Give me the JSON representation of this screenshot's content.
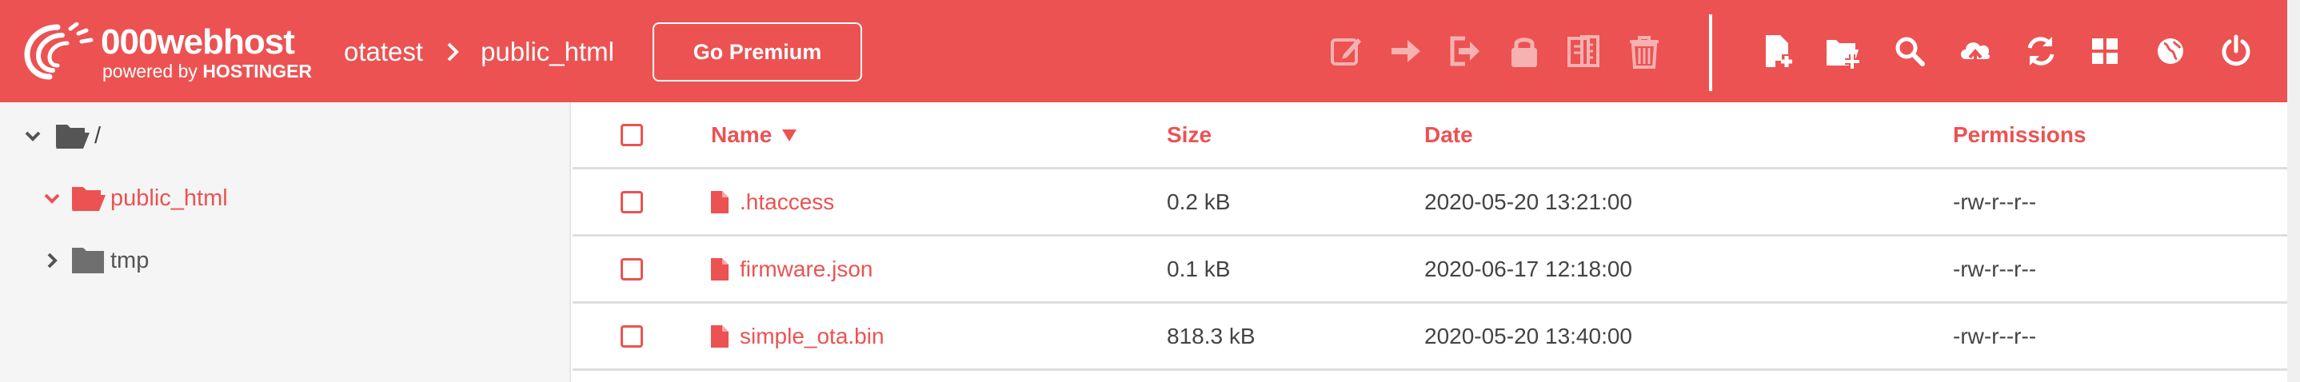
{
  "colors": {
    "brand": "#ec5252",
    "white": "#ffffff",
    "text": "#444444",
    "sidebar_bg": "#f5f5f5",
    "folder_gray": "#6f6f6f"
  },
  "header": {
    "logo_name": "000webhost",
    "logo_powered": "powered by",
    "logo_brand": "HOSTINGER",
    "breadcrumb": [
      "otatest",
      "public_html"
    ],
    "premium_label": "Go Premium",
    "toolbar_icons": [
      "edit-icon",
      "move-arrow-icon",
      "logout-arrow-icon",
      "lock-icon",
      "archive-icon",
      "trash-icon",
      "new-file-icon",
      "new-folder-icon",
      "search-icon",
      "upload-cloud-icon",
      "refresh-icon",
      "grid-view-icon",
      "globe-icon",
      "power-icon"
    ]
  },
  "tree": {
    "root": "/",
    "items": [
      {
        "label": "public_html",
        "state": "expanded",
        "active": true
      },
      {
        "label": "tmp",
        "state": "collapsed",
        "active": false
      }
    ]
  },
  "table": {
    "columns": {
      "name": "Name",
      "size": "Size",
      "date": "Date",
      "permissions": "Permissions"
    },
    "sort_column": "Name",
    "sort_direction": "descending",
    "rows": [
      {
        "name": ".htaccess",
        "size": "0.2 kB",
        "date": "2020-05-20 13:21:00",
        "permissions": "-rw-r--r--"
      },
      {
        "name": "firmware.json",
        "size": "0.1 kB",
        "date": "2020-06-17 12:18:00",
        "permissions": "-rw-r--r--"
      },
      {
        "name": "simple_ota.bin",
        "size": "818.3 kB",
        "date": "2020-05-20 13:40:00",
        "permissions": "-rw-r--r--"
      }
    ]
  }
}
